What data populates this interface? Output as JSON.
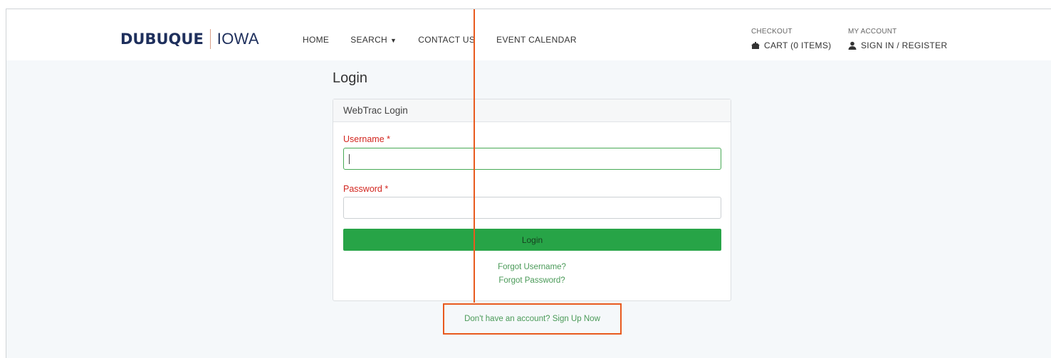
{
  "brand": {
    "city": "DUBUQUE",
    "state": "IOWA"
  },
  "nav": {
    "home": "HOME",
    "search": "SEARCH",
    "contact": "CONTACT US",
    "calendar": "EVENT CALENDAR"
  },
  "checkout": {
    "heading": "CHECKOUT",
    "cart": "CART (0 ITEMS)"
  },
  "account": {
    "heading": "MY ACCOUNT",
    "signin": "SIGN IN / REGISTER"
  },
  "page": {
    "title": "Login"
  },
  "form": {
    "header": "WebTrac Login",
    "username_label": "Username *",
    "username_value": "",
    "password_label": "Password *",
    "password_value": "",
    "login_button": "Login",
    "forgot_username": "Forgot Username?",
    "forgot_password": "Forgot Password?"
  },
  "signup": {
    "text": "Don't have an account? Sign Up Now"
  },
  "colors": {
    "brand_navy": "#1e2f5c",
    "accent_green": "#27a447",
    "required_red": "#d2261f",
    "highlight_orange": "#e85a1e"
  }
}
